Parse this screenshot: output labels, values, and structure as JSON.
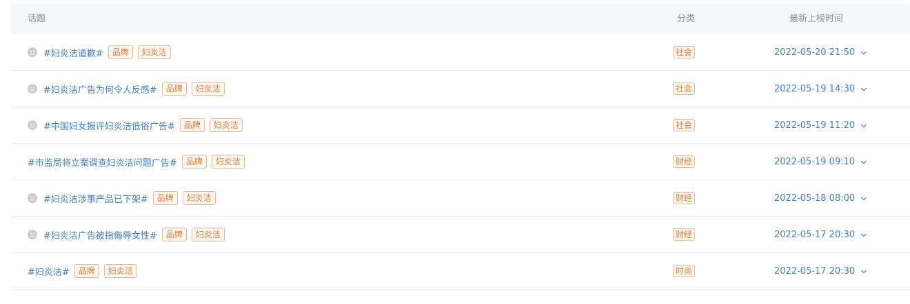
{
  "header": {
    "topic": "话题",
    "category": "分类",
    "time": "最新上榜时间"
  },
  "rows": [
    {
      "topic": "#妇炎洁道歉#",
      "has_icon": true,
      "tags": [
        "品牌",
        "妇炎洁"
      ],
      "category": "社会",
      "time": "2022-05-20 21:50"
    },
    {
      "topic": "#妇炎洁广告为何令人反感#",
      "has_icon": true,
      "tags": [
        "品牌",
        "妇炎洁"
      ],
      "category": "社会",
      "time": "2022-05-19 14:30"
    },
    {
      "topic": "#中国妇女报评妇炎洁低俗广告#",
      "has_icon": true,
      "tags": [
        "品牌",
        "妇炎洁"
      ],
      "category": "社会",
      "time": "2022-05-19 11:20"
    },
    {
      "topic": "#市监局将立案调查妇炎洁问题广告#",
      "has_icon": false,
      "tags": [
        "品牌",
        "妇炎洁"
      ],
      "category": "财经",
      "time": "2022-05-19 09:10"
    },
    {
      "topic": "#妇炎洁涉事产品已下架#",
      "has_icon": true,
      "tags": [
        "品牌",
        "妇炎洁"
      ],
      "category": "财经",
      "time": "2022-05-18 08:00"
    },
    {
      "topic": "#妇炎洁广告被指侮辱女性#",
      "has_icon": true,
      "tags": [
        "品牌",
        "妇炎洁"
      ],
      "category": "财经",
      "time": "2022-05-17 20:30"
    },
    {
      "topic": "#妇炎洁#",
      "has_icon": false,
      "tags": [
        "品牌",
        "妇炎洁"
      ],
      "category": "时尚",
      "time": "2022-05-17 20:30"
    }
  ],
  "icons": {
    "row_avatar": "sad-face-icon",
    "expand": "chevron-down-icon"
  },
  "colors": {
    "link": "#3d7fd6",
    "tag_text": "#ee7b2f",
    "tag_border": "#f5b48a",
    "header_bg": "#f5f7fa"
  }
}
